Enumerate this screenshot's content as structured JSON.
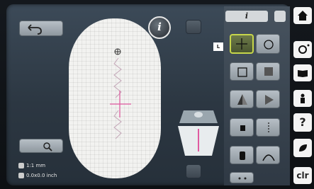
{
  "info_button": {
    "label": "i"
  },
  "panel": {
    "header_label": "i"
  },
  "tooltip": {
    "label": "L"
  },
  "status": {
    "line1": "1:1 mm",
    "line2": "0.0x0.0 inch"
  },
  "sidebar": {
    "clr_label": "clr",
    "help_label": "?"
  },
  "colors": {
    "accent": "#c7d64a",
    "stitch": "#e05aa0",
    "hoop": "#f2f2f0"
  }
}
